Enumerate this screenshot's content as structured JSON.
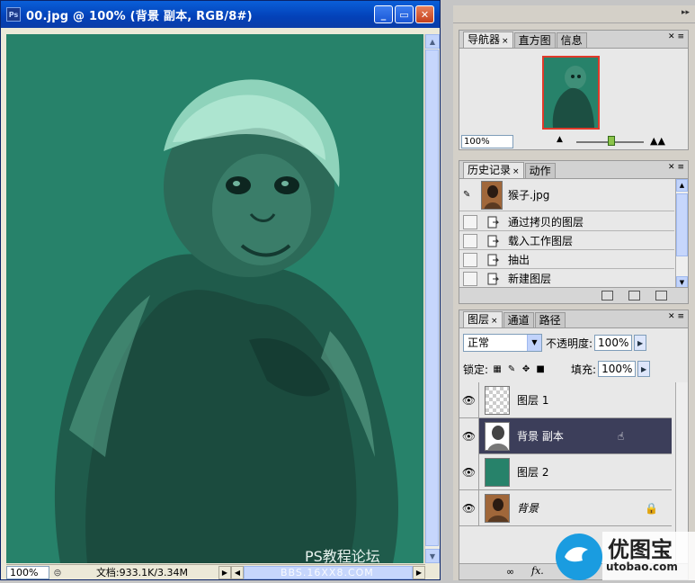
{
  "document": {
    "title": "00.jpg @ 100% (背景 副本, RGB/8#)",
    "zoom": "100%",
    "doc_info": "文档:933.1K/3.34M",
    "watermark": "PS教程论坛",
    "scroll_watermark": "BBS.16XX8.COM"
  },
  "colors": {
    "canvas": "#27826a",
    "titlebar": "#0a5fd8",
    "selected_layer": "#3c3e5a"
  },
  "navigator": {
    "tabs": [
      "导航器",
      "直方图",
      "信息"
    ],
    "zoom": "100%"
  },
  "history": {
    "tabs": [
      "历史记录",
      "动作"
    ],
    "snapshot": "猴子.jpg",
    "steps": [
      "通过拷贝的图层",
      "载入工作图层",
      "抽出",
      "新建图层"
    ]
  },
  "layers": {
    "tabs": [
      "图层",
      "通道",
      "路径"
    ],
    "blend_mode": "正常",
    "opacity_label": "不透明度:",
    "opacity": "100%",
    "lock_label": "锁定:",
    "fill_label": "填充:",
    "fill": "100%",
    "items": [
      "图层 1",
      "背景 副本",
      "图层 2",
      "背景"
    ]
  },
  "logo": {
    "name": "优图宝",
    "url": "utobao.com"
  }
}
